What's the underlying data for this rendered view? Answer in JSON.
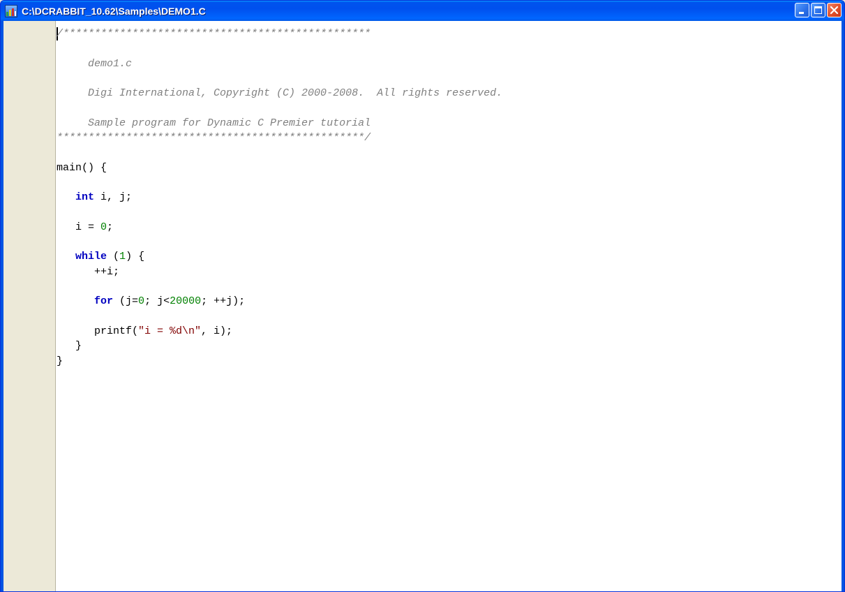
{
  "window": {
    "title": "C:\\DCRABBIT_10.62\\Samples\\DEMO1.C",
    "icon": "dynamic-c-app-icon",
    "buttons": {
      "minimize": "minimize-icon",
      "maximize": "maximize-icon",
      "close": "close-icon"
    }
  },
  "editor": {
    "lines": [
      {
        "segments": [
          {
            "t": "/*************************************************",
            "c": "comment"
          }
        ]
      },
      {
        "segments": []
      },
      {
        "segments": [
          {
            "t": "     demo1.c",
            "c": "comment"
          }
        ]
      },
      {
        "segments": []
      },
      {
        "segments": [
          {
            "t": "     Digi International, Copyright (C) 2000-2008.  All rights reserved.",
            "c": "comment"
          }
        ]
      },
      {
        "segments": []
      },
      {
        "segments": [
          {
            "t": "     Sample program for Dynamic C Premier tutorial",
            "c": "comment"
          }
        ]
      },
      {
        "segments": [
          {
            "t": "*************************************************/",
            "c": "comment"
          }
        ]
      },
      {
        "segments": []
      },
      {
        "segments": [
          {
            "t": "main() {",
            "c": "plain"
          }
        ]
      },
      {
        "segments": []
      },
      {
        "segments": [
          {
            "t": "   ",
            "c": "plain"
          },
          {
            "t": "int",
            "c": "kw"
          },
          {
            "t": " i, j;",
            "c": "plain"
          }
        ]
      },
      {
        "segments": []
      },
      {
        "segments": [
          {
            "t": "   i = ",
            "c": "plain"
          },
          {
            "t": "0",
            "c": "num"
          },
          {
            "t": ";",
            "c": "plain"
          }
        ]
      },
      {
        "segments": []
      },
      {
        "segments": [
          {
            "t": "   ",
            "c": "plain"
          },
          {
            "t": "while",
            "c": "kw"
          },
          {
            "t": " (",
            "c": "plain"
          },
          {
            "t": "1",
            "c": "num"
          },
          {
            "t": ") {",
            "c": "plain"
          }
        ]
      },
      {
        "segments": [
          {
            "t": "      ++i;",
            "c": "plain"
          }
        ]
      },
      {
        "segments": []
      },
      {
        "segments": [
          {
            "t": "      ",
            "c": "plain"
          },
          {
            "t": "for",
            "c": "kw"
          },
          {
            "t": " (j=",
            "c": "plain"
          },
          {
            "t": "0",
            "c": "num"
          },
          {
            "t": "; j<",
            "c": "plain"
          },
          {
            "t": "20000",
            "c": "num"
          },
          {
            "t": "; ++j);",
            "c": "plain"
          }
        ]
      },
      {
        "segments": []
      },
      {
        "segments": [
          {
            "t": "      printf(",
            "c": "plain"
          },
          {
            "t": "\"i = %d\\n\"",
            "c": "str"
          },
          {
            "t": ", i);",
            "c": "plain"
          }
        ]
      },
      {
        "segments": [
          {
            "t": "   }",
            "c": "plain"
          }
        ]
      },
      {
        "segments": [
          {
            "t": "}",
            "c": "plain"
          }
        ]
      }
    ],
    "colors": {
      "comment": "#808080",
      "keyword": "#0000C0",
      "number": "#008000",
      "string": "#800000",
      "gutter": "#ECE9D8"
    }
  }
}
